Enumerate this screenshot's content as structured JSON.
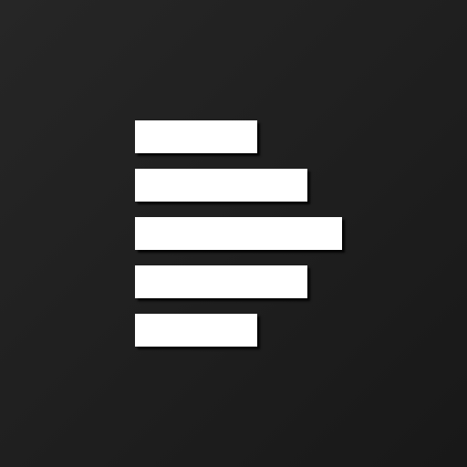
{
  "app_icon": {
    "icon": "stacked-bars-logo-icon",
    "background_color": "#1f1f1f",
    "bar_color": "#ffffff",
    "bar_count": 5
  }
}
